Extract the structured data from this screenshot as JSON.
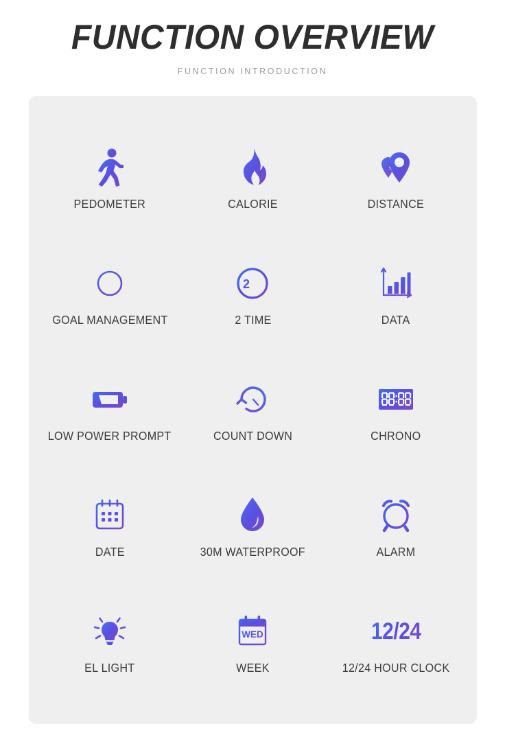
{
  "header": {
    "title": "FUNCTION OVERVIEW",
    "subtitle": "FUNCTION INTRODUCTION"
  },
  "colors": {
    "background": "#ffffff",
    "card_background": "#efefef",
    "title_text": "#2e2e2e",
    "subtitle_text": "#9a9a9a",
    "label_text": "#3c3c3c",
    "gradient_start": "#3d6ff0",
    "gradient_mid": "#5b4fe0",
    "gradient_end": "#7c49c9"
  },
  "features": [
    {
      "label": "PEDOMETER",
      "icon": "running-person-icon"
    },
    {
      "label": "CALORIE",
      "icon": "flame-icon"
    },
    {
      "label": "DISTANCE",
      "icon": "map-pin-icon"
    },
    {
      "label": "GOAL MANAGEMENT",
      "icon": "crosshair-target-icon"
    },
    {
      "label": "2 TIME",
      "icon": "dual-time-clock-icon"
    },
    {
      "label": "DATA",
      "icon": "bar-chart-icon"
    },
    {
      "label": "LOW POWER PROMPT",
      "icon": "battery-icon"
    },
    {
      "label": "COUNT DOWN",
      "icon": "clock-counterclockwise-icon"
    },
    {
      "label": "CHRONO",
      "icon": "digital-display-icon",
      "icon_text": "00:00"
    },
    {
      "label": "DATE",
      "icon": "calendar-grid-icon"
    },
    {
      "label": "30M WATERPROOF",
      "icon": "water-droplet-icon"
    },
    {
      "label": "ALARM",
      "icon": "alarm-clock-icon"
    },
    {
      "label": "EL LIGHT",
      "icon": "light-bulb-icon"
    },
    {
      "label": "WEEK",
      "icon": "calendar-weekday-icon",
      "icon_text": "WED"
    },
    {
      "label": "12/24 HOUR CLOCK",
      "icon": "twelve-twentyfour-text-icon",
      "icon_text": "12/24"
    }
  ]
}
